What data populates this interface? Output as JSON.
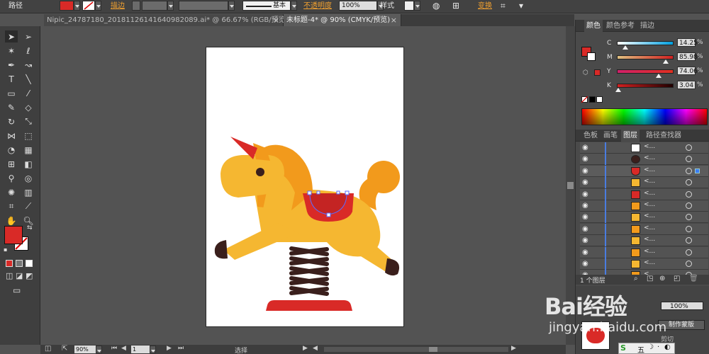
{
  "control_bar": {
    "path_label": "路径",
    "stroke_label": "描边",
    "stroke_style": "基本",
    "opacity_label": "不透明度",
    "opacity_value": "100%",
    "style_label": "样式",
    "transform_link": "变换"
  },
  "tabs": [
    {
      "label": "Nipic_24787180_20181126141640982089.ai* @ 66.67% (RGB/预览)"
    },
    {
      "label": "未标题-4* @ 90% (CMYK/预览)"
    }
  ],
  "color_panel": {
    "tabs": [
      "颜色",
      "颜色参考",
      "描边"
    ],
    "channels": [
      {
        "name": "C",
        "value": "14.25",
        "unit": "%"
      },
      {
        "name": "M",
        "value": "85.98",
        "unit": "%"
      },
      {
        "name": "Y",
        "value": "74.06",
        "unit": "%"
      },
      {
        "name": "K",
        "value": "3.04",
        "unit": "%"
      }
    ],
    "fill_color": "#d92a27"
  },
  "layers_panel": {
    "tabs": [
      "色板",
      "画笔",
      "图层",
      "路径查找器"
    ],
    "item_name": "<...",
    "footer_count": "1 个图层"
  },
  "bottom_panel": {
    "field_value": "100%",
    "make_mask_button": "制作蒙版",
    "clip_label": "剪切"
  },
  "status_bar": {
    "zoom": "90%",
    "page": "1",
    "tool_name": "选择"
  },
  "watermark": {
    "brand": "Bai经验",
    "url": "jingyan.baidu.com"
  },
  "taskbar": {
    "ime_label": "五"
  },
  "colors": {
    "yellow": "#f5b731",
    "orange": "#f29a1c",
    "red": "#d92a27",
    "dark": "#3a1f1c",
    "ui_bg": "#535353"
  }
}
